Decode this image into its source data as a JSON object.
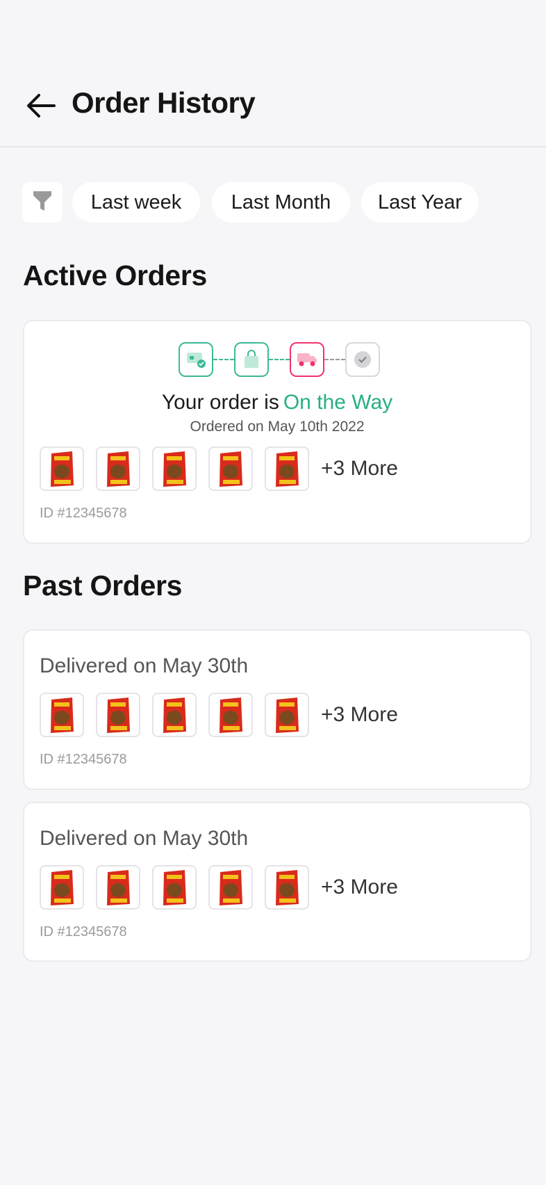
{
  "header": {
    "title": "Order History"
  },
  "filters": {
    "chips": [
      "Last week",
      "Last Month",
      "Last Year"
    ]
  },
  "active": {
    "section_title": "Active Orders",
    "status_prefix": "Your order is",
    "status_value": "On the Way",
    "ordered_on": "Ordered on May 10th 2022",
    "more": "+3 More",
    "id": "ID #12345678",
    "steps": [
      "payment-icon",
      "bag-icon",
      "truck-icon",
      "check-icon"
    ]
  },
  "past": {
    "section_title": "Past Orders",
    "orders": [
      {
        "delivered": "Delivered on May 30th",
        "more": "+3 More",
        "id": "ID #12345678"
      },
      {
        "delivered": "Delivered on May 30th",
        "more": "+3 More",
        "id": "ID #12345678"
      }
    ]
  },
  "colors": {
    "accent_green": "#27b07f",
    "accent_pink": "#f0336c",
    "background": "#f6f5f8"
  }
}
